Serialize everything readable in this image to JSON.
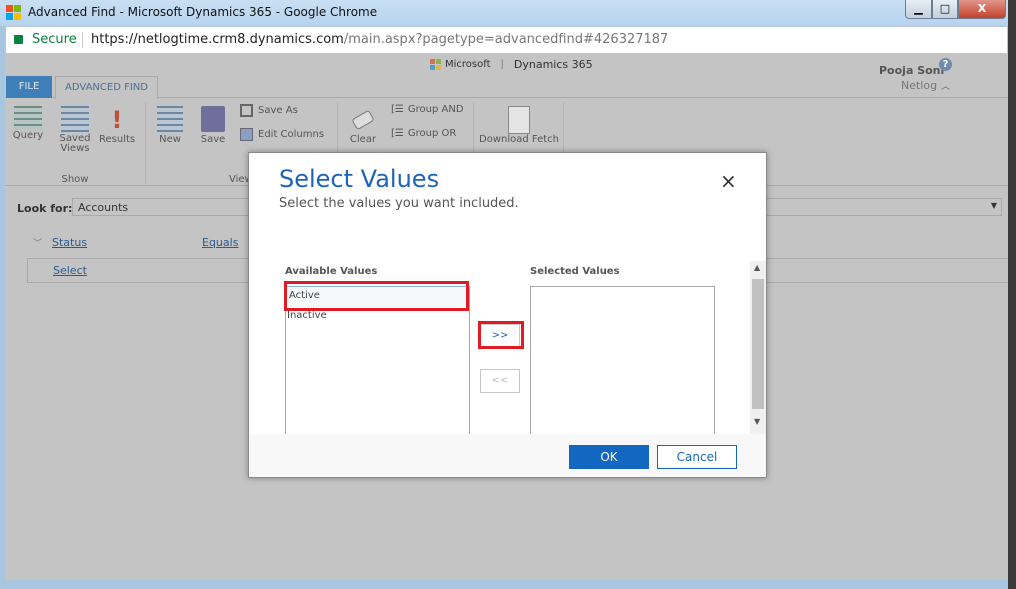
{
  "window": {
    "title": "Advanced Find - Microsoft Dynamics 365 - Google Chrome",
    "minimize": "▁",
    "maximize": "□",
    "close": "X"
  },
  "address": {
    "secure": "Secure",
    "url_host": "https://netlogtime.crm8.dynamics.com",
    "url_path": "/main.aspx?pagetype=advancedfind#426327187"
  },
  "header": {
    "brand": "Microsoft",
    "product": "Dynamics 365",
    "user": "Pooja Soni",
    "org": "Netlog",
    "help": "?"
  },
  "ribbon": {
    "tabs": [
      {
        "label": "FILE"
      },
      {
        "label": "ADVANCED FIND"
      }
    ],
    "buttons": {
      "query": "Query",
      "saved_views": "Saved Views",
      "results": "Results",
      "new": "New",
      "save": "Save",
      "save_as": "Save As",
      "edit_columns": "Edit Columns",
      "clear": "Clear",
      "group_and": "Group AND",
      "group_or": "Group OR",
      "download_fetch": "Download Fetch"
    },
    "groups": {
      "show": "Show",
      "view": "View"
    }
  },
  "query": {
    "look_for_label": "Look for:",
    "look_for_value": "Accounts",
    "field": "Status",
    "operator": "Equals",
    "value": "Select"
  },
  "dialog": {
    "title": "Select Values",
    "subtitle": "Select the values you want included.",
    "close": "×",
    "available_label": "Available Values",
    "available": [
      "Active",
      "Inactive"
    ],
    "selected_label": "Selected Values",
    "selected": [],
    "add": ">>",
    "remove": "<<",
    "ok": "OK",
    "cancel": "Cancel"
  },
  "colors": {
    "accent": "#1467c0",
    "highlight": "#e01b24",
    "file_tab": "#3f7fb7"
  }
}
